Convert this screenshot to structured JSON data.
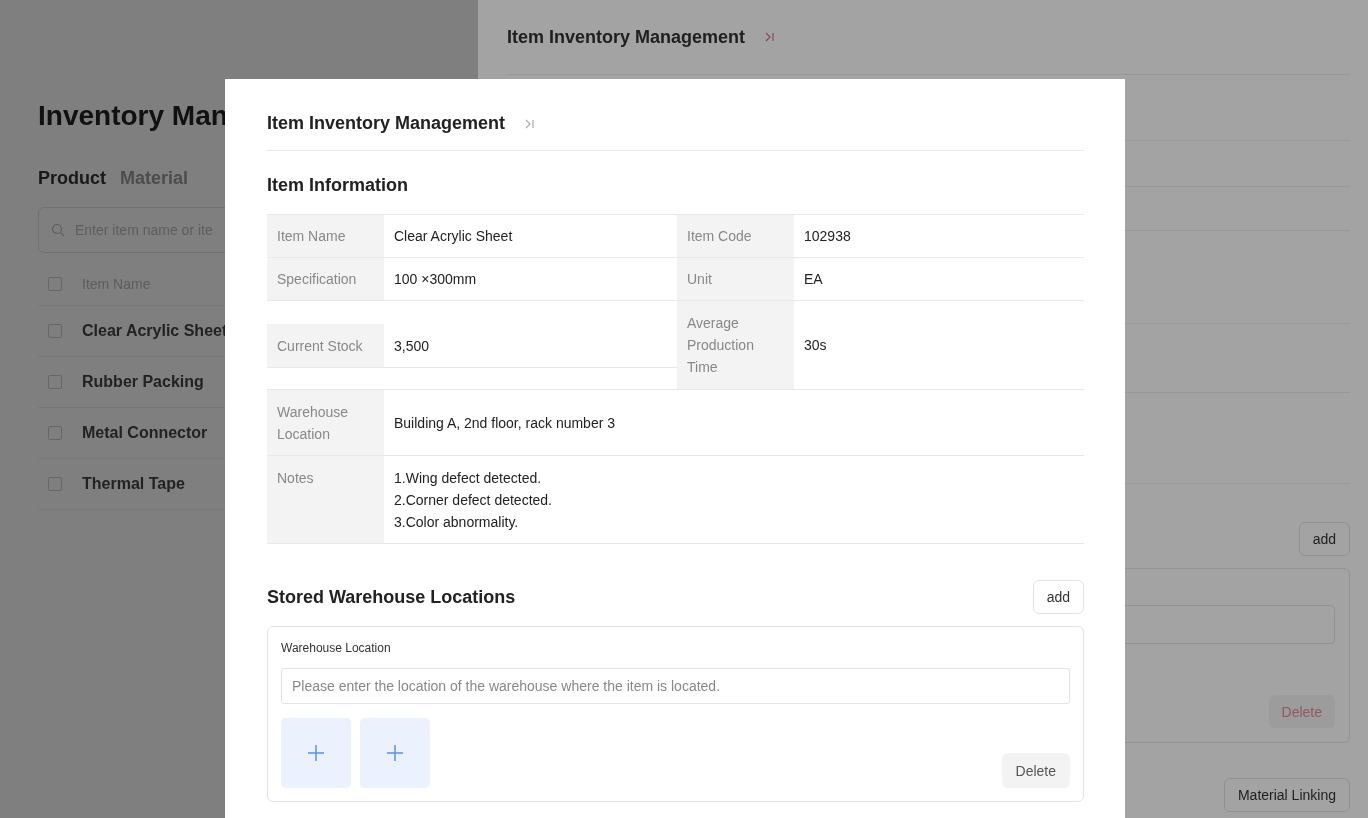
{
  "background": {
    "page_title": "Inventory Man",
    "tabs": [
      {
        "label": "Product",
        "selected": true
      },
      {
        "label": "Material",
        "selected": false
      }
    ],
    "search": {
      "placeholder": "Enter item name or ite"
    },
    "column_header": {
      "label": "Item Name",
      "checked": false
    },
    "rows": [
      {
        "name": "Clear Acrylic Sheet",
        "checked": false
      },
      {
        "name": "Rubber Packing",
        "checked": false
      },
      {
        "name": "Metal Connector",
        "checked": false
      },
      {
        "name": "Thermal Tape",
        "checked": false
      }
    ]
  },
  "drawer": {
    "title": "Item Inventory Management",
    "add_button": "add",
    "delete_button": "Delete",
    "link_button": "Material Linking"
  },
  "modal": {
    "title": "Item Inventory Management",
    "section_title": "Item Information",
    "info_rows": [
      {
        "kind": "pair",
        "cells": [
          {
            "label": "Item Name",
            "value": "Clear Acrylic Sheet"
          },
          {
            "label": "Item Code",
            "value": "102938"
          }
        ]
      },
      {
        "kind": "pair",
        "cells": [
          {
            "label": "Specification",
            "value": "100 ×300mm"
          },
          {
            "label": "Unit",
            "value": "EA"
          }
        ]
      },
      {
        "kind": "tall",
        "cells": [
          {
            "label": "Current Stock",
            "value": "3,500"
          },
          {
            "label": "Average Production Time",
            "value": "30s"
          }
        ]
      },
      {
        "kind": "wide",
        "label": "Warehouse Location",
        "value": "Building A, 2nd floor, rack number 3"
      },
      {
        "kind": "lines",
        "label": "Notes",
        "lines": [
          "1.Wing defect detected.",
          "2.Corner defect detected.",
          "3.Color abnormality."
        ]
      }
    ],
    "locations_title": "Stored Warehouse Locations",
    "add_button": "add",
    "location": {
      "label": "Warehouse Location",
      "placeholder": "Please enter the location of the warehouse where the item is located.",
      "upload_slots": [
        {
          "kind": "add"
        },
        {
          "kind": "add"
        }
      ],
      "delete_button": "Delete"
    }
  }
}
